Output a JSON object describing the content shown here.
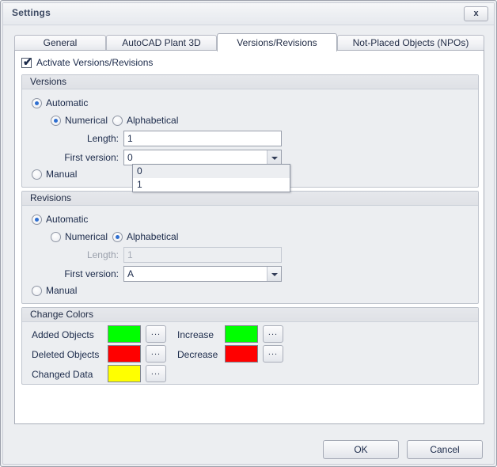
{
  "window": {
    "title": "Settings",
    "close_label": "x"
  },
  "tabs": [
    {
      "label": "General",
      "active": false
    },
    {
      "label": "AutoCAD Plant 3D",
      "active": false
    },
    {
      "label": "Versions/Revisions",
      "active": true
    },
    {
      "label": "Not-Placed Objects (NPOs)",
      "active": false
    }
  ],
  "activate": {
    "label": "Activate Versions/Revisions",
    "checked": true,
    "check_glyph": "✔"
  },
  "versions": {
    "title": "Versions",
    "automatic_label": "Automatic",
    "automatic_selected": true,
    "numerical_label": "Numerical",
    "numerical_selected": true,
    "alphabetical_label": "Alphabetical",
    "alphabetical_selected": false,
    "length_label": "Length:",
    "length_value": "1",
    "length_disabled": false,
    "first_version_label": "First version:",
    "first_version_value": "0",
    "first_version_open": true,
    "first_version_options": [
      "0",
      "1"
    ],
    "first_version_selected_index": 0,
    "manual_label": "Manual",
    "manual_selected": false
  },
  "revisions": {
    "title": "Revisions",
    "automatic_label": "Automatic",
    "automatic_selected": true,
    "numerical_label": "Numerical",
    "numerical_selected": false,
    "alphabetical_label": "Alphabetical",
    "alphabetical_selected": true,
    "length_label": "Length:",
    "length_value": "1",
    "length_disabled": true,
    "first_version_label": "First version:",
    "first_version_value": "A",
    "manual_label": "Manual",
    "manual_selected": false
  },
  "change_colors": {
    "title": "Change Colors",
    "browse_label": "...",
    "left_items": [
      {
        "label": "Added Objects",
        "color": "#00FF00"
      },
      {
        "label": "Deleted Objects",
        "color": "#FF0000"
      },
      {
        "label": "Changed Data",
        "color": "#FFFF00"
      }
    ],
    "right_items": [
      {
        "label": "Increase",
        "color": "#00FF00"
      },
      {
        "label": "Decrease",
        "color": "#FF0000"
      }
    ]
  },
  "footer": {
    "ok_label": "OK",
    "cancel_label": "Cancel"
  }
}
